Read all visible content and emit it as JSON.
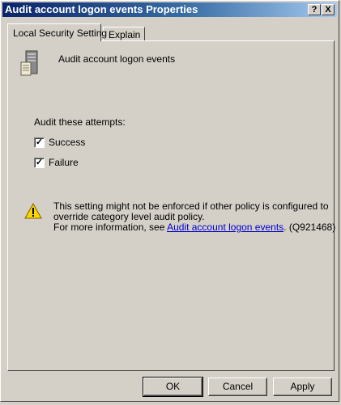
{
  "window": {
    "title": "Audit account logon events Properties",
    "help_label": "?",
    "close_label": "X"
  },
  "tabs": [
    {
      "label": "Local Security Setting",
      "active": true
    },
    {
      "label": "Explain",
      "active": false
    }
  ],
  "policy": {
    "icon": "server-policy-icon",
    "name": "Audit account logon events"
  },
  "audit": {
    "label": "Audit these attempts:",
    "options": [
      {
        "label": "Success",
        "checked": true
      },
      {
        "label": "Failure",
        "checked": true
      }
    ]
  },
  "warning": {
    "icon": "warning-icon",
    "line1": "This setting might not be enforced if other policy is configured to",
    "line2": "override category level audit policy.",
    "line3_prefix": "For more information, see ",
    "link_text": "Audit account logon events",
    "line3_suffix": ". (Q921468)"
  },
  "buttons": {
    "ok": "OK",
    "cancel": "Cancel",
    "apply": "Apply"
  }
}
